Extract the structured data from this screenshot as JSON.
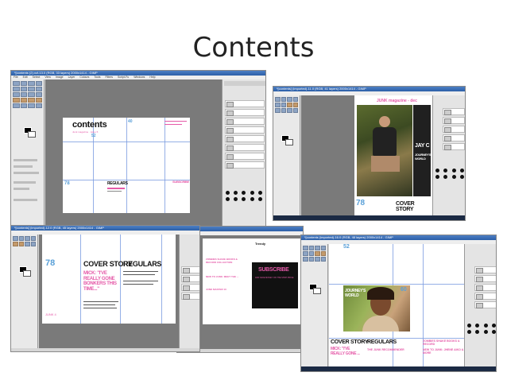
{
  "slide": {
    "title": "Contents"
  },
  "window1": {
    "titlebar": "*[contents (2).xcf-13.0 (RGB, 33 layers) 2000x1414 - GIMP",
    "menu": [
      "File",
      "Edit",
      "Select",
      "View",
      "Image",
      "Layer",
      "Colours",
      "Tools",
      "Filters",
      "Script-Fu",
      "Windows",
      "Help"
    ],
    "canvas": {
      "heading": "contents",
      "sub": "Junk magazine · issue 5",
      "page_40": "40",
      "page_78": "78",
      "regulars": "REGULARS",
      "subscribe": "SUBSCRIBE",
      "num_52": "52"
    }
  },
  "window2": {
    "titlebar": "*[contents] (imported)-11.0 (RGB, 41 layers) 2000x1414 - GIMP",
    "canvas": {
      "masthead": "JUNK magazine - dec",
      "jay": "JAY C",
      "journey": "JOURNEY'S WORLD",
      "num": "78",
      "cover_story": "COVER STORY"
    }
  },
  "window3": {
    "titlebar": "*[contents] (imported)-12.0 (RGB, 45 layers) 2000x1414 - GIMP",
    "canvas": {
      "num": "78",
      "cover_story": "COVER STORY",
      "regulars": "REGULARS",
      "quote": "MICK: \"I'VE REALLY GONE BONKERS THIS TIME...\"",
      "footer": "JUNK 4"
    }
  },
  "window4": {
    "canvas": {
      "brand": "Trendy",
      "heading": "ZOMBIES SHAKE BOOKS & RECORD COLLECTION",
      "item2": "NEW TO JUNK: MEET THE ...",
      "item3": "JUNK MASTER 10",
      "subscribe": "SUBSCRIBE",
      "subscribe_sub": "AND SAVE MONEY ON THE SHOP PRICE"
    }
  },
  "window5": {
    "titlebar": "*[contents (imported)-16.0 (RGB, 48 layers) 2000x1414 - GIMP",
    "canvas": {
      "num_top": "52",
      "journey": "JOURNEY'S WORLD",
      "num_60": "60",
      "cover_story": "COVER STORY",
      "regulars": "REGULARS",
      "quote": "MICK: \"I'VE REALLY GONE ...",
      "zombies": "ZOMBIES SHAKE BOOKS & RECORD",
      "recommender": "THE JUNK RECOMMENDER",
      "newto": "NEW TO JUNK: JHENE AIKO & MORE"
    }
  }
}
